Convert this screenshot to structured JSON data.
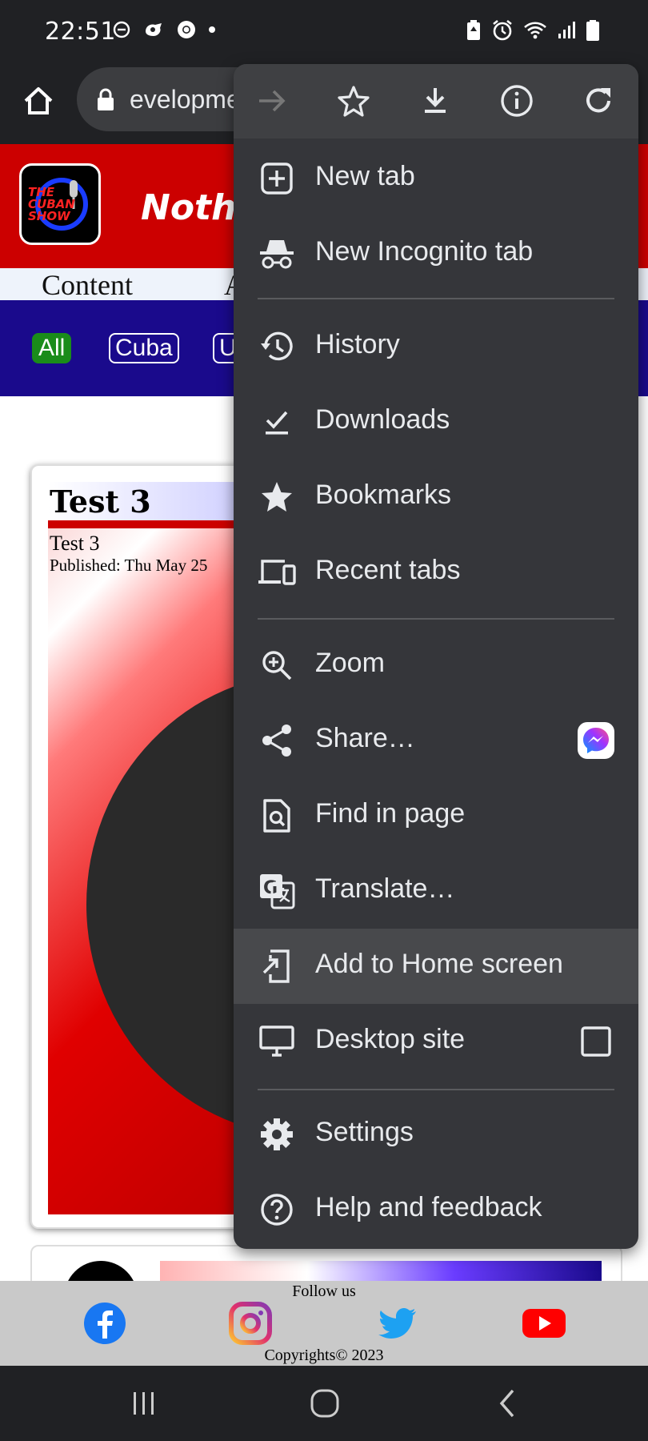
{
  "status_bar": {
    "time": "22:51",
    "left_icons": [
      "do-not-disturb-icon",
      "hand-icon",
      "chrome-icon",
      "dot-icon"
    ],
    "right_icons": [
      "battery-saver-icon",
      "alarm-icon",
      "wifi-icon",
      "signal-icon",
      "battery-icon"
    ]
  },
  "browser": {
    "url_text": "evelopme",
    "home_icon": "home-icon",
    "lock_icon": "lock-icon"
  },
  "website": {
    "logo_text": "THE CUBAN SHOW",
    "slogan": "Nothi",
    "nav_items": [
      "Content",
      "A"
    ],
    "filter_chips": [
      "All",
      "Cuba",
      "U"
    ],
    "card": {
      "title": "Test 3",
      "subtitle": "Test 3",
      "published": "Published: Thu May 25"
    },
    "footer": {
      "follow": "Follow us",
      "copyright": "Copyrights© 2023",
      "social": [
        "facebook-icon",
        "instagram-icon",
        "twitter-icon",
        "youtube-icon"
      ]
    }
  },
  "menu": {
    "top_icons": [
      "forward-icon",
      "bookmark-star-icon",
      "download-icon",
      "info-icon",
      "reload-icon"
    ],
    "items": [
      {
        "label": "New tab",
        "icon": "new-tab-icon"
      },
      {
        "label": "New Incognito tab",
        "icon": "incognito-icon"
      },
      {
        "label": "History",
        "icon": "history-icon"
      },
      {
        "label": "Downloads",
        "icon": "downloads-icon"
      },
      {
        "label": "Bookmarks",
        "icon": "star-icon"
      },
      {
        "label": "Recent tabs",
        "icon": "devices-icon"
      },
      {
        "label": "Zoom",
        "icon": "zoom-icon"
      },
      {
        "label": "Share…",
        "icon": "share-icon",
        "trailing": "messenger-icon"
      },
      {
        "label": "Find in page",
        "icon": "find-in-page-icon"
      },
      {
        "label": "Translate…",
        "icon": "translate-icon"
      },
      {
        "label": "Add to Home screen",
        "icon": "add-to-home-icon",
        "highlighted": true
      },
      {
        "label": "Desktop site",
        "icon": "desktop-icon",
        "trailing": "checkbox",
        "checked": false
      },
      {
        "label": "Settings",
        "icon": "settings-icon"
      },
      {
        "label": "Help and feedback",
        "icon": "help-icon"
      }
    ]
  },
  "nav_bar": [
    "recents-icon",
    "home-icon",
    "back-icon"
  ],
  "colors": {
    "menu_bg": "#35363a",
    "menu_highlight": "#48494c",
    "site_red": "#cc0000",
    "site_blue": "#1a0a8c",
    "chip_green": "#1a8c1a"
  }
}
